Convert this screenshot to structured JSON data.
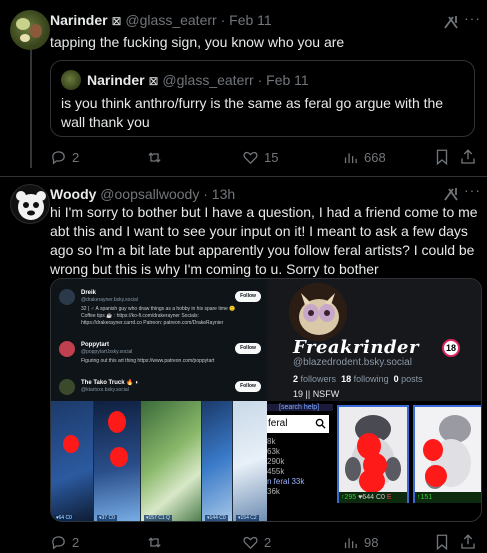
{
  "post1": {
    "author": "Narinder",
    "badge": "⊠",
    "handle": "@glass_eaterr",
    "time": "Feb 11",
    "text": "tapping the fucking sign, you know who you are",
    "quote": {
      "author": "Narinder",
      "badge": "⊠",
      "handle": "@glass_eaterr",
      "time": "Feb 11",
      "text": "is you think anthro/furry is the same as feral go argue with the wall thank you"
    },
    "actions": {
      "replies": "2",
      "reposts": "",
      "likes": "15",
      "views": "668"
    }
  },
  "post2": {
    "author": "Woody",
    "handle": "@oopsallwoody",
    "time": "13h",
    "text": "hi I'm sorry to bother but I have a question, I had a friend come to me abt this and I want to see your input on it! I meant to ask a few days ago so I'm a bit late but apparently you follow feral artists? I could be wrong but this is why I'm coming to u. Sorry to bother",
    "media": {
      "left_list": [
        {
          "name": "Dreik",
          "handle": "@drakerayner.bsky.social",
          "bio": "32 | ♂ A spanish guy who draw things as a hobby in his spare time 🙂 Coffee tips ☕ : https://ko-fi.com/drakerayner Socials: https://drakerayner.carrd.co Patreon: patreon.com/DrakeRaynier",
          "follow": "Follow"
        },
        {
          "name": "Poppytart",
          "handle": "@poppytart.bsky.social",
          "bio": "Figuring out this art thing https://www.patreon.com/poppytart",
          "follow": "Follow"
        },
        {
          "name": "The Tako Truck 🔥 ◐",
          "handle": "@ktartxxx.bsky.social",
          "bio": "",
          "follow": "Follow"
        }
      ],
      "profile": {
        "display_name": "Freakrinder",
        "age_badge": "18",
        "handle": "@blazedrodent.bsky.social",
        "followers_count": "2",
        "followers_label": "followers",
        "following_count": "18",
        "following_label": "following",
        "posts_count": "0",
        "posts_label": "posts",
        "tags": "19 || NSFW"
      },
      "gallery_stats": [
        "▾64 C0",
        "▾37 C0",
        "▾157 C1 Q",
        "▾144 C0",
        "▾154 C2"
      ],
      "search": {
        "header": "[search help]",
        "value": "feral",
        "results": [
          "8k",
          "63k",
          "290k",
          "455k",
          "n feral 33k",
          "36k"
        ]
      },
      "cards": [
        {
          "score": "↑295",
          "favs": "♥644",
          "comments": "C0",
          "rating": "E"
        },
        {
          "score": "↑151",
          "favs": "",
          "comments": "",
          "rating": ""
        }
      ]
    },
    "actions": {
      "replies": "2",
      "reposts": "",
      "likes": "2",
      "views": "98"
    }
  },
  "colors": {
    "background": "#000000",
    "text": "#e7e9ea",
    "muted": "#71767b",
    "border": "#2f3336"
  }
}
